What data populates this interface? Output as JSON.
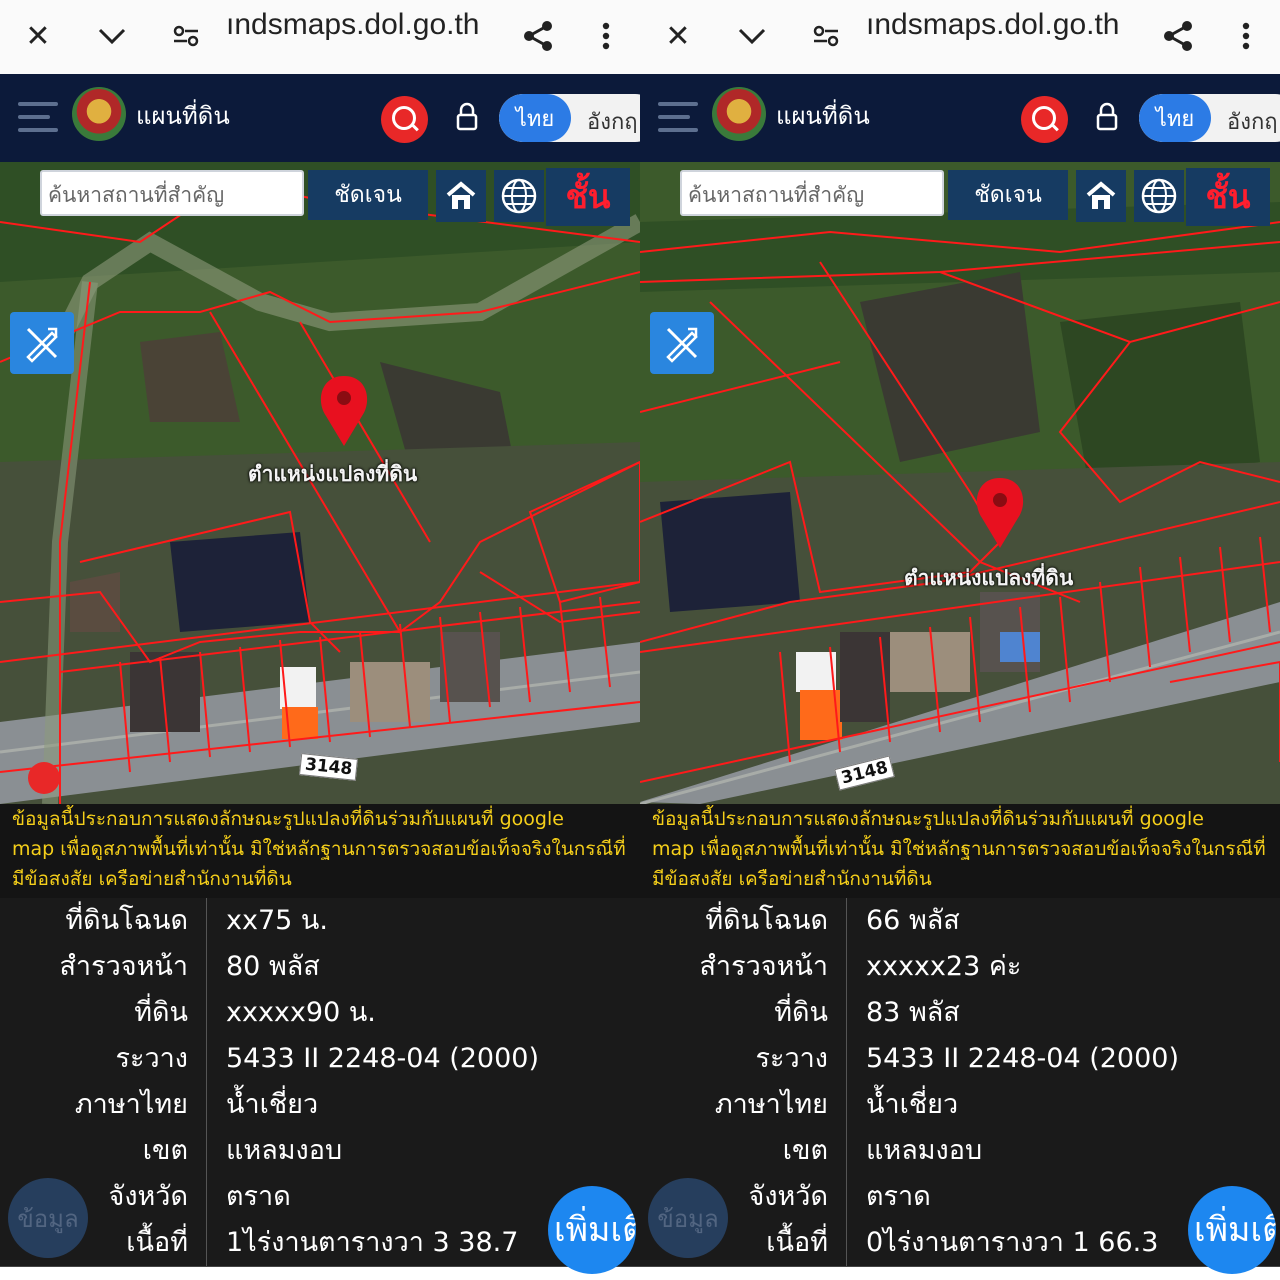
{
  "browser": {
    "url": "ındsmaps.dol.go.th"
  },
  "app": {
    "title": "แผนที่ดิน",
    "lang_th": "ไทย",
    "lang_en": "อังกฤ"
  },
  "map": {
    "search_placeholder": "ค้นหาสถานที่สำคัญ",
    "clear_label": "ชัดเจน",
    "layer_label": "ชั้น",
    "pin_label": "ตำแหน่งแปลงที่ดิน",
    "route_sign": "3148"
  },
  "disclaimer": {
    "line1": "ข้อมูลนี้ประกอบการแสดงลักษณะรูปแปลงที่ดินร่วมกับแผนที่ google",
    "line2": "map เพื่อดูสภาพพื้นที่เท่านั้น มิใช่หลักฐานการตรวจสอบข้อเท็จจริงในกรณีที่",
    "line3": "มีข้อสงสัย เครือข่ายสำนักงานที่ดิน"
  },
  "more_label": "เพิ่มเติ",
  "ghost_label": "ข้อมูล",
  "left": {
    "rows": [
      {
        "k": "ที่ดินโฉนด",
        "v": "xx75 น."
      },
      {
        "k": "สำรวจหน้า",
        "v": "80 พลัส"
      },
      {
        "k": "ที่ดิน",
        "v": "xxxxx90 น."
      },
      {
        "k": "ระวาง",
        "v": "5433 II 2248-04 (2000)"
      },
      {
        "k": "ภาษาไทย",
        "v": "น้ำเชี่ยว"
      },
      {
        "k": "เขต",
        "v": "แหลมงอบ"
      },
      {
        "k": "จังหวัด",
        "v": "ตราด"
      },
      {
        "k": "เนื้อที่",
        "v": "1ไร่งานตารางวา 3 38.7"
      }
    ]
  },
  "right": {
    "rows": [
      {
        "k": "ที่ดินโฉนด",
        "v": "66 พลัส"
      },
      {
        "k": "สำรวจหน้า",
        "v": "xxxxx23 ค่ะ"
      },
      {
        "k": "ที่ดิน",
        "v": "83 พลัส"
      },
      {
        "k": "ระวาง",
        "v": "5433 II 2248-04 (2000)"
      },
      {
        "k": "ภาษาไทย",
        "v": "น้ำเชี่ยว"
      },
      {
        "k": "เขต",
        "v": "แหลมงอบ"
      },
      {
        "k": "จังหวัด",
        "v": "ตราด"
      },
      {
        "k": "เนื้อที่",
        "v": "0ไร่งานตารางวา 1 66.3"
      }
    ]
  },
  "colors": {
    "header_bg": "#0c1a3a",
    "accent_blue": "#2c7be5",
    "search_red": "#e82828",
    "disclaimer_text": "#f5cf1a",
    "parcel_line": "#ff1a1a"
  }
}
